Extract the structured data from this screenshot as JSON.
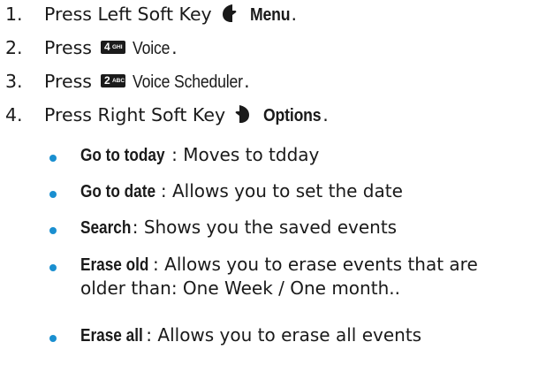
{
  "steps": [
    {
      "number": "1.",
      "text": "Press Left Soft Key",
      "bold_label": "Menu",
      "suffix": "."
    },
    {
      "number": "2.",
      "text": "Press",
      "key": {
        "digit": "4",
        "letters": "GHI"
      },
      "label": "Voice",
      "suffix": "."
    },
    {
      "number": "3.",
      "text": "Press",
      "key": {
        "digit": "2",
        "letters": "ABC"
      },
      "label": "Voice Scheduler",
      "suffix": "."
    },
    {
      "number": "4.",
      "text": "Press Right Soft Key",
      "bold_label": "Options",
      "suffix": "."
    }
  ],
  "options": [
    {
      "term": "Go to today",
      "description": ": Moves to tdday"
    },
    {
      "term": "Go to date",
      "description": ": Allows you to set the date"
    },
    {
      "term": "Search",
      "description": ": Shows you the saved events"
    },
    {
      "term": "Erase old",
      "description": ": Allows you to erase events that are",
      "description_line2": "older than: One Week / One month.."
    },
    {
      "term": "Erase all",
      "description": ": Allows you to erase all events"
    }
  ],
  "icons": {
    "left_soft_key": "left-soft-key-icon",
    "right_soft_key": "right-soft-key-icon"
  },
  "colors": {
    "bullet": "#1a8fd0",
    "text": "#1a1a1a",
    "key_background": "#1b1b1b"
  }
}
